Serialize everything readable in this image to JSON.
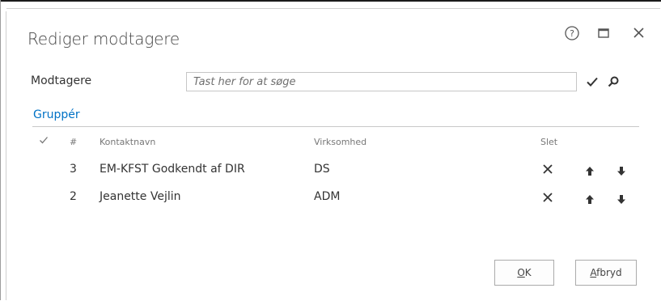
{
  "dialog": {
    "title": "Rediger modtagere",
    "help_icon": "question-circle-icon",
    "maximize_icon": "maximize-icon",
    "close_icon": "close-icon"
  },
  "recipients": {
    "label": "Modtagere",
    "search_placeholder": "Tast her for at søge",
    "search_value": "",
    "check_icon": "checkmark-icon",
    "search_icon": "magnifier-icon"
  },
  "group_link": "Gruppér",
  "table": {
    "headers": {
      "check": "checkmark-icon",
      "number": "#",
      "contact": "Kontaktnavn",
      "company": "Virksomhed",
      "delete": "Slet"
    },
    "rows": [
      {
        "number": "3",
        "contact": "EM-KFST Godkendt af DIR",
        "company": "DS"
      },
      {
        "number": "2",
        "contact": "Jeanette Vejlin",
        "company": "ADM"
      }
    ],
    "row_icons": {
      "delete": "x-icon",
      "up": "arrow-up-icon",
      "down": "arrow-down-icon"
    }
  },
  "buttons": {
    "ok_mnemonic": "O",
    "ok_rest": "K",
    "cancel_mnemonic": "A",
    "cancel_rest": "fbryd"
  },
  "colors": {
    "link": "#0072c6",
    "text": "#333333",
    "header_text": "#777777"
  }
}
